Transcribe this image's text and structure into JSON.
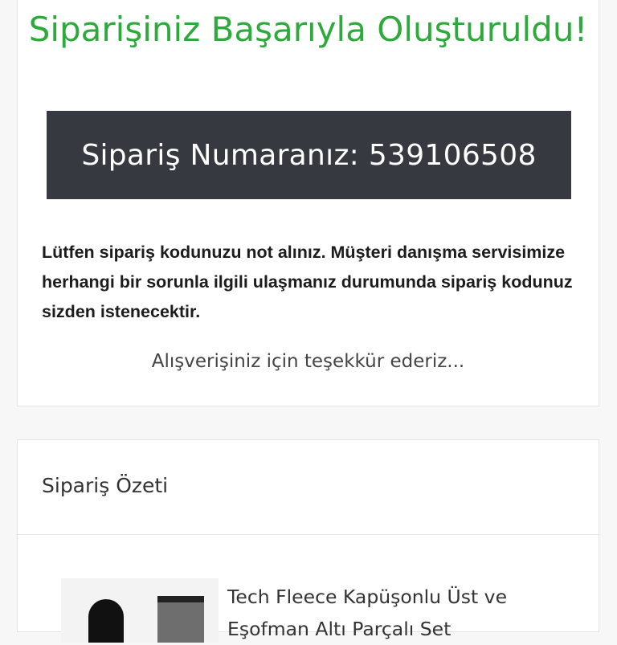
{
  "success": {
    "title": "Siparişiniz Başarıyla Oluşturuldu!",
    "order_label": "Sipariş Numaranız: 539106508",
    "notice": "Lütfen sipariş kodunuzu not alınız. Müşteri danışma servisimize herhangi bir sorunla ilgili ulaşmanız durumunda sipariş kodunuz sizden istenecektir.",
    "thanks": "Alışverişiniz için teşekkür ederiz..."
  },
  "summary": {
    "title": "Sipariş Özeti",
    "items": [
      {
        "name": "Tech Fleece Kapüşonlu Üst ve Eşofman Altı Parçalı Set"
      }
    ]
  },
  "colors": {
    "success_green": "#2eaa3c",
    "order_box_bg": "#363a40"
  }
}
